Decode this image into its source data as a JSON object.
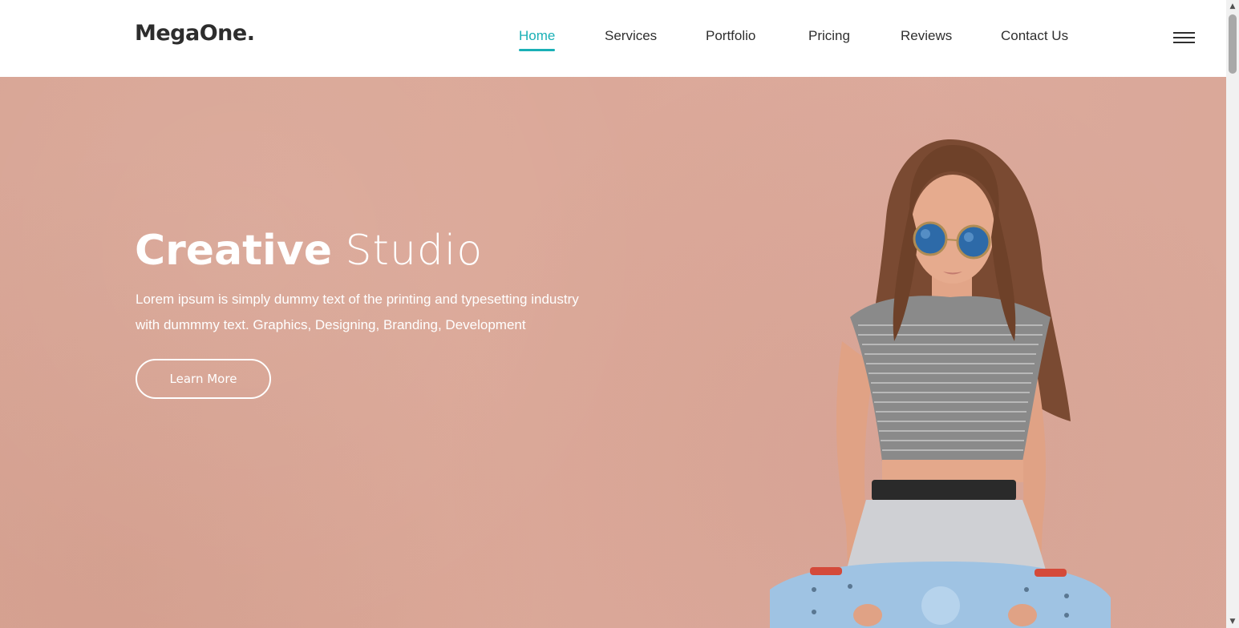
{
  "header": {
    "logo": "MegaOne.",
    "nav": [
      {
        "label": "Home",
        "active": true
      },
      {
        "label": "Services",
        "active": false
      },
      {
        "label": "Portfolio",
        "active": false
      },
      {
        "label": "Pricing",
        "active": false
      },
      {
        "label": "Reviews",
        "active": false
      },
      {
        "label": "Contact Us",
        "active": false
      }
    ],
    "menu_icon": "hamburger-menu-icon"
  },
  "hero": {
    "title_bold": "Creative",
    "title_light": "Studio",
    "description_line1": "Lorem ipsum is simply dummy text of the printing and typesetting industry",
    "description_line2": "with dummmy text. Graphics, Designing, Branding, Development",
    "button_label": "Learn More"
  },
  "colors": {
    "accent": "#1ab0b6",
    "hero_background": "#dba898",
    "text_dark": "#2f2f2f"
  }
}
